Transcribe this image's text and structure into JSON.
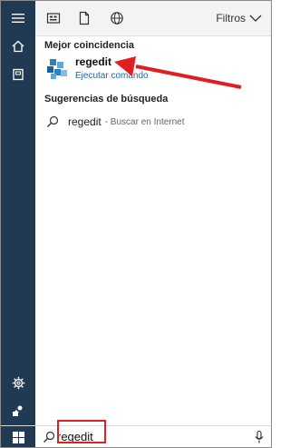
{
  "topbar": {
    "filters_label": "Filtros"
  },
  "results": {
    "best_match_title": "Mejor coincidencia",
    "best_match_name": "regedit",
    "best_match_sub": "Ejecutar comando",
    "suggestions_title": "Sugerencias de búsqueda",
    "suggestion_query": "regedit",
    "suggestion_hint": "- Buscar en Internet"
  },
  "search": {
    "value": "regedit"
  },
  "colors": {
    "rail": "#1f3a52",
    "accent": "#1a67b4",
    "annotation": "#e02020"
  }
}
